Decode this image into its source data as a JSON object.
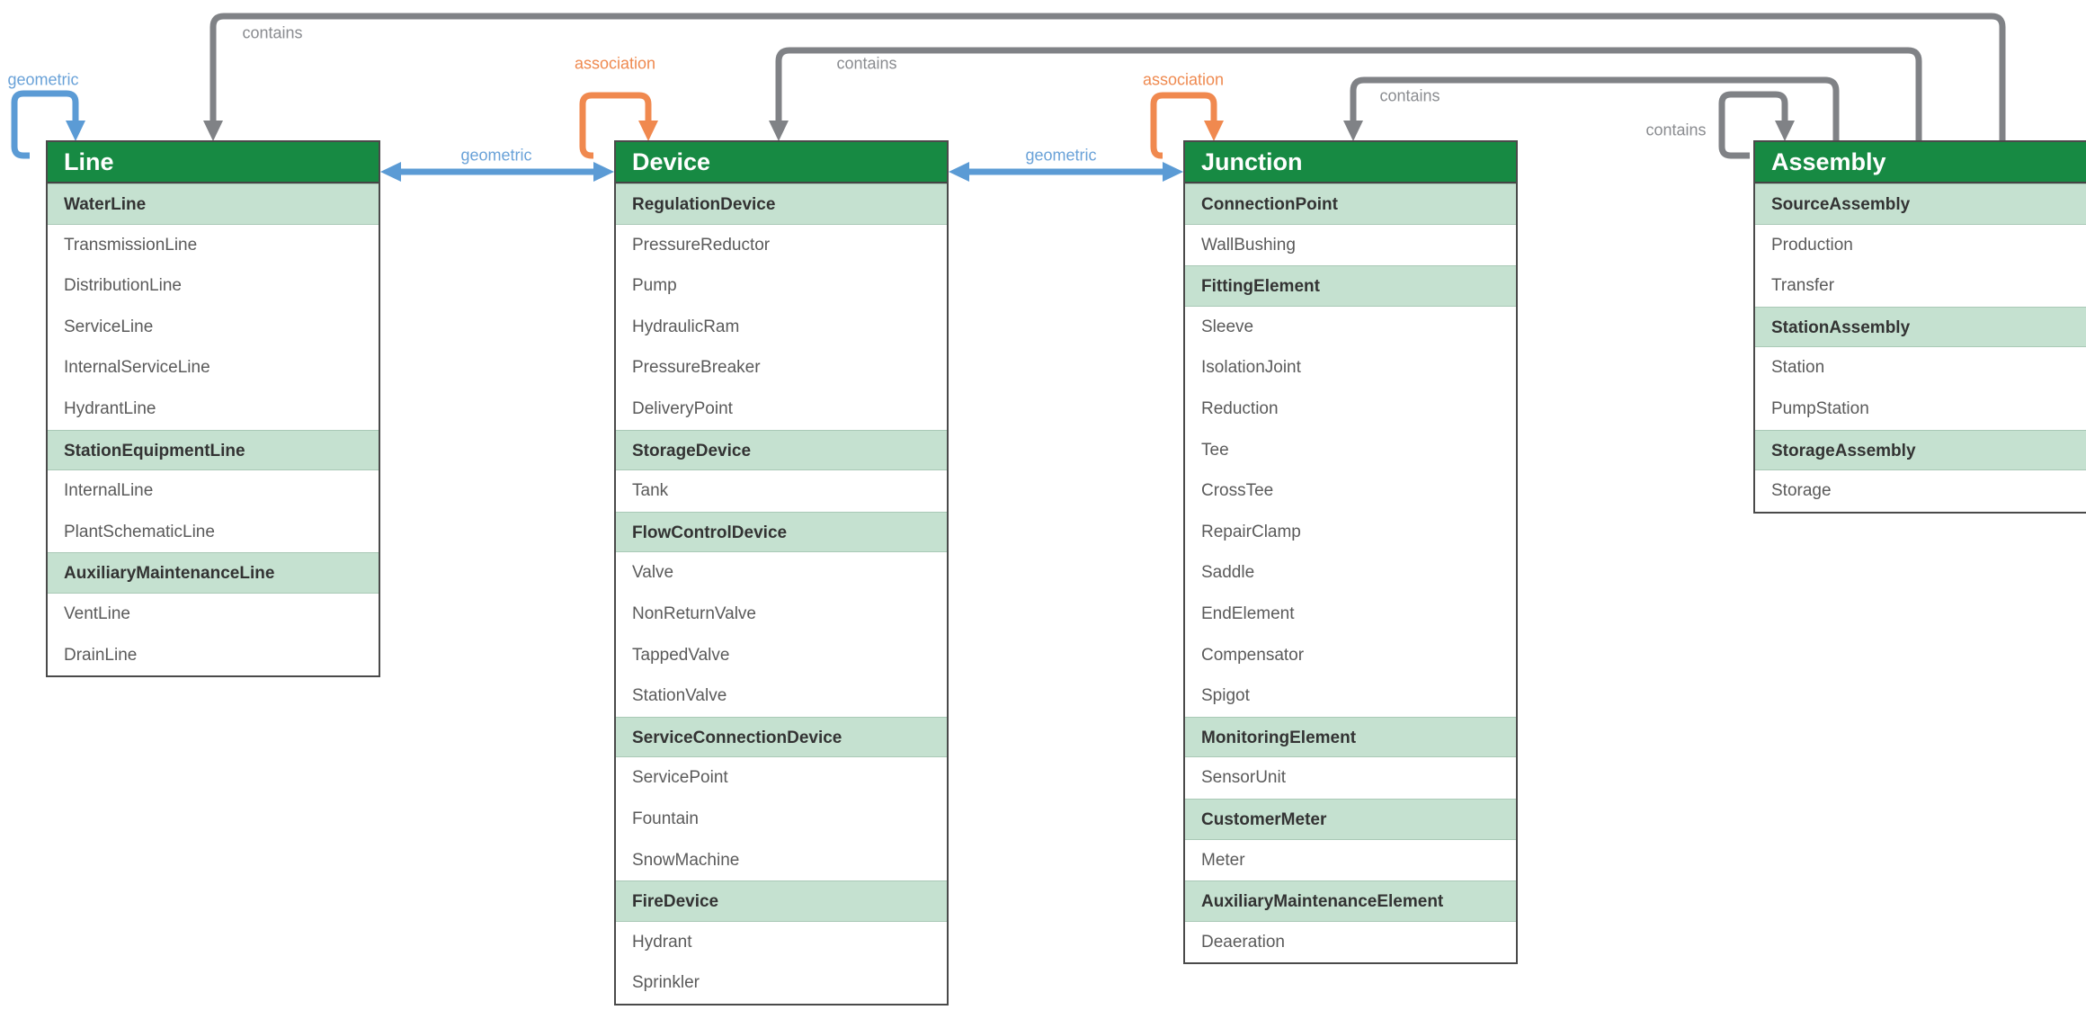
{
  "colors": {
    "header": "#178a43",
    "category": "#c5e1d0",
    "geometric": "#5b9bd5",
    "association": "#f0894f",
    "contains": "#808286"
  },
  "relations": {
    "line_self": "geometric",
    "line_device": "geometric",
    "device_junction": "geometric",
    "device_self": "association",
    "junction_self": "association",
    "assembly_line": "contains",
    "assembly_device": "contains",
    "assembly_junction": "contains",
    "assembly_self": "contains"
  },
  "boxes": [
    {
      "id": "line",
      "title": "Line",
      "items": [
        {
          "label": "WaterLine",
          "category": true
        },
        {
          "label": "TransmissionLine"
        },
        {
          "label": "DistributionLine"
        },
        {
          "label": "ServiceLine"
        },
        {
          "label": "InternalServiceLine"
        },
        {
          "label": "HydrantLine"
        },
        {
          "label": "StationEquipmentLine",
          "category": true
        },
        {
          "label": "InternalLine"
        },
        {
          "label": "PlantSchematicLine"
        },
        {
          "label": "AuxiliaryMaintenanceLine",
          "category": true
        },
        {
          "label": "VentLine"
        },
        {
          "label": "DrainLine"
        }
      ]
    },
    {
      "id": "device",
      "title": "Device",
      "items": [
        {
          "label": "RegulationDevice",
          "category": true
        },
        {
          "label": "PressureReductor"
        },
        {
          "label": "Pump"
        },
        {
          "label": "HydraulicRam"
        },
        {
          "label": "PressureBreaker"
        },
        {
          "label": "DeliveryPoint"
        },
        {
          "label": "StorageDevice",
          "category": true
        },
        {
          "label": "Tank"
        },
        {
          "label": "FlowControlDevice",
          "category": true
        },
        {
          "label": "Valve"
        },
        {
          "label": "NonReturnValve"
        },
        {
          "label": "TappedValve"
        },
        {
          "label": "StationValve"
        },
        {
          "label": "ServiceConnectionDevice",
          "category": true
        },
        {
          "label": "ServicePoint"
        },
        {
          "label": "Fountain"
        },
        {
          "label": "SnowMachine"
        },
        {
          "label": "FireDevice",
          "category": true
        },
        {
          "label": "Hydrant"
        },
        {
          "label": "Sprinkler"
        }
      ]
    },
    {
      "id": "junction",
      "title": "Junction",
      "items": [
        {
          "label": "ConnectionPoint",
          "category": true
        },
        {
          "label": "WallBushing"
        },
        {
          "label": "FittingElement",
          "category": true
        },
        {
          "label": "Sleeve"
        },
        {
          "label": "IsolationJoint"
        },
        {
          "label": "Reduction"
        },
        {
          "label": "Tee"
        },
        {
          "label": "CrossTee"
        },
        {
          "label": "RepairClamp"
        },
        {
          "label": "Saddle"
        },
        {
          "label": "EndElement"
        },
        {
          "label": "Compensator"
        },
        {
          "label": "Spigot"
        },
        {
          "label": "MonitoringElement",
          "category": true
        },
        {
          "label": "SensorUnit"
        },
        {
          "label": "CustomerMeter",
          "category": true
        },
        {
          "label": "Meter"
        },
        {
          "label": "AuxiliaryMaintenanceElement",
          "category": true
        },
        {
          "label": "Deaeration"
        }
      ]
    },
    {
      "id": "assembly",
      "title": "Assembly",
      "items": [
        {
          "label": "SourceAssembly",
          "category": true
        },
        {
          "label": "Production"
        },
        {
          "label": "Transfer"
        },
        {
          "label": "StationAssembly",
          "category": true
        },
        {
          "label": "Station"
        },
        {
          "label": "PumpStation"
        },
        {
          "label": "StorageAssembly",
          "category": true
        },
        {
          "label": "Storage"
        }
      ]
    }
  ]
}
